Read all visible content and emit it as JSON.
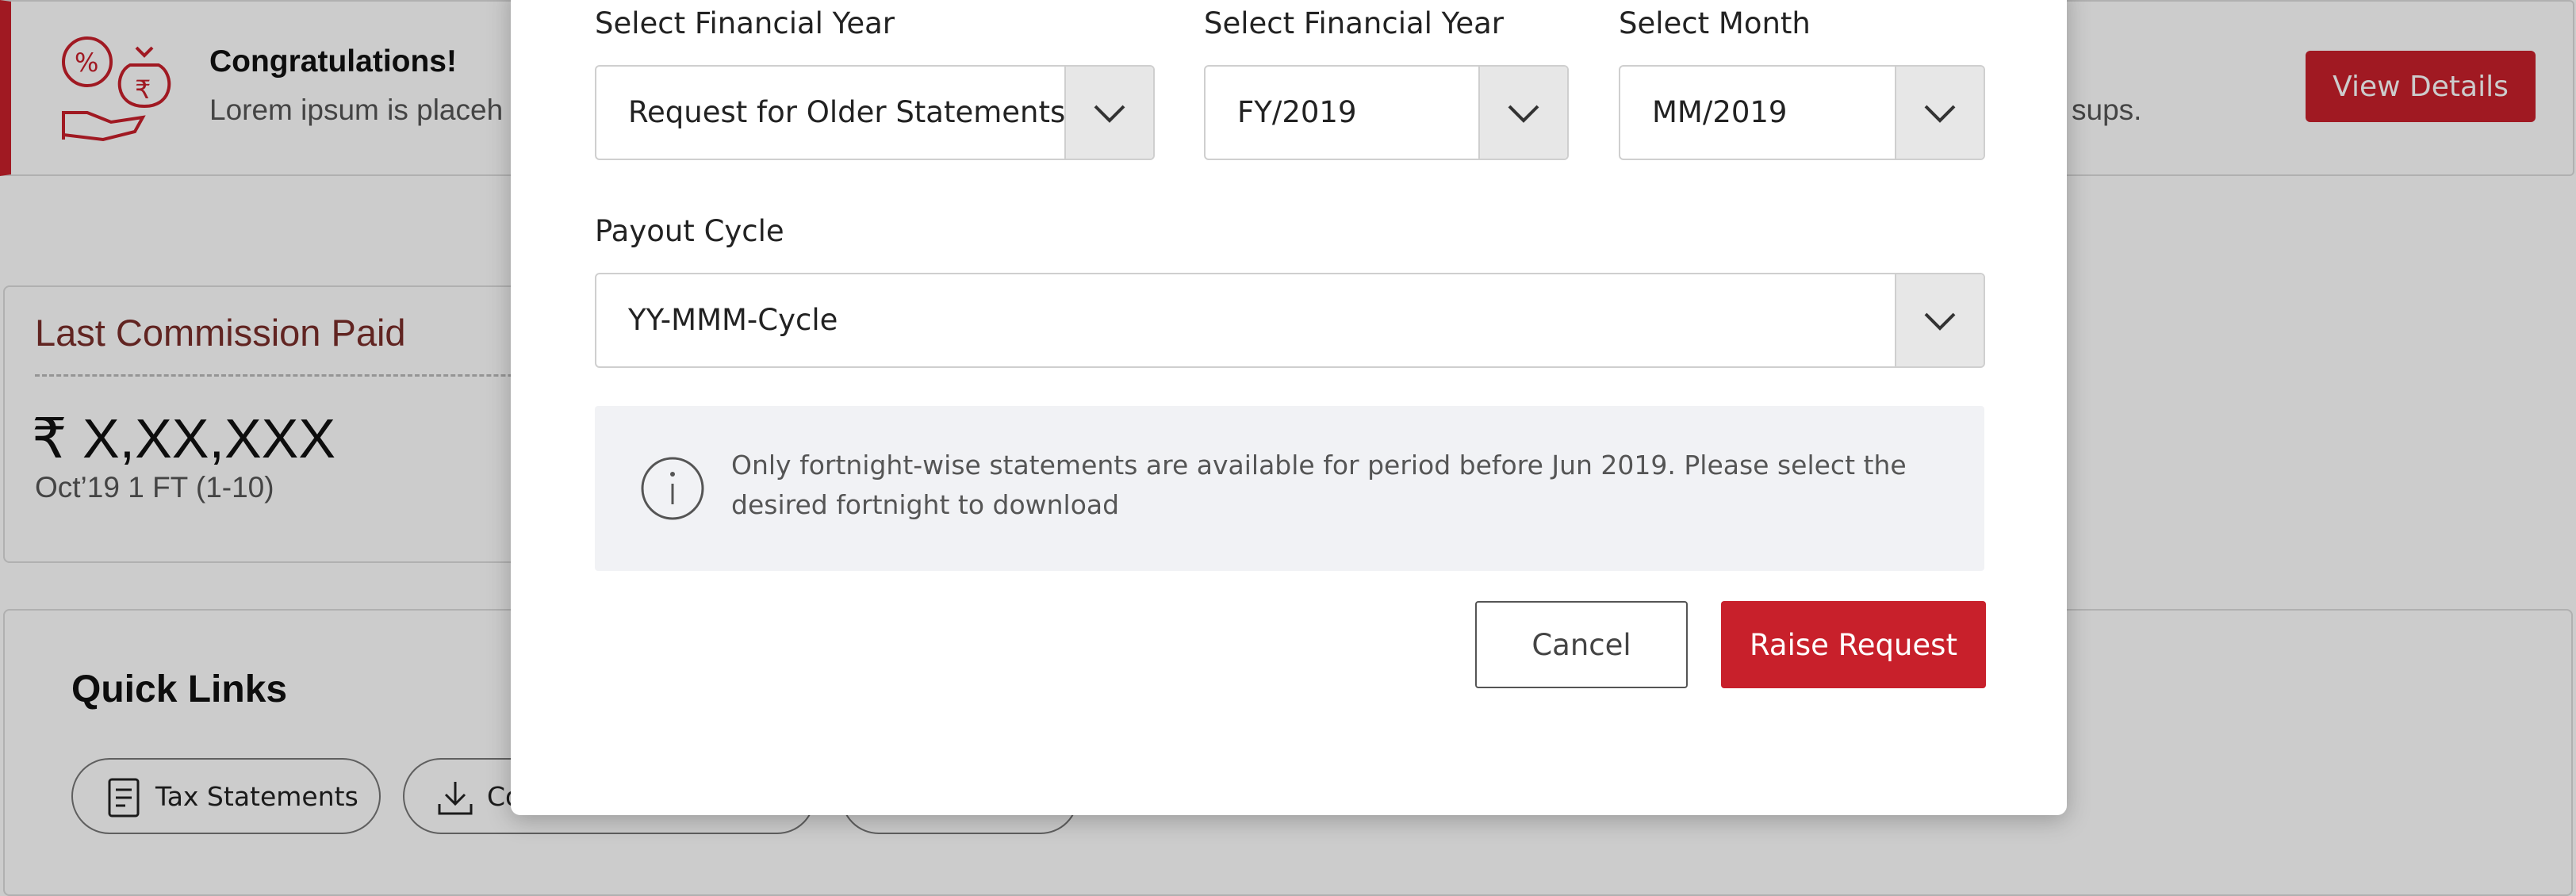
{
  "banner": {
    "title": "Congratulations!",
    "text": "Lorem ipsum is placeh",
    "text_tail": "sups.",
    "button_label": "View Details"
  },
  "commission": {
    "title": "Last Commission Paid",
    "amount": "₹ X,XX,XXX",
    "period": "Oct’19 1 FT (1-10)"
  },
  "quick_links": {
    "title": "Quick Links",
    "chips": [
      {
        "label": "Tax Statements"
      },
      {
        "label": "Co"
      },
      {
        "label": ""
      }
    ]
  },
  "modal": {
    "fields": {
      "statement_type": {
        "label": "Select Financial Year",
        "value": "Request for Older Statements"
      },
      "financial_year": {
        "label": "Select Financial Year",
        "value": "FY/2019"
      },
      "month": {
        "label": "Select Month",
        "value": "MM/2019"
      },
      "payout_cycle": {
        "label": "Payout Cycle",
        "value": "YY-MMM-Cycle"
      }
    },
    "info_text": "Only fortnight-wise statements are available for period before Jun 2019. Please select the desired fortnight to download",
    "cancel_label": "Cancel",
    "raise_label": "Raise Request"
  },
  "colors": {
    "accent": "#c8202b",
    "overlay": "rgba(0,0,0,0.2)",
    "info_bg": "#f1f2f5"
  }
}
